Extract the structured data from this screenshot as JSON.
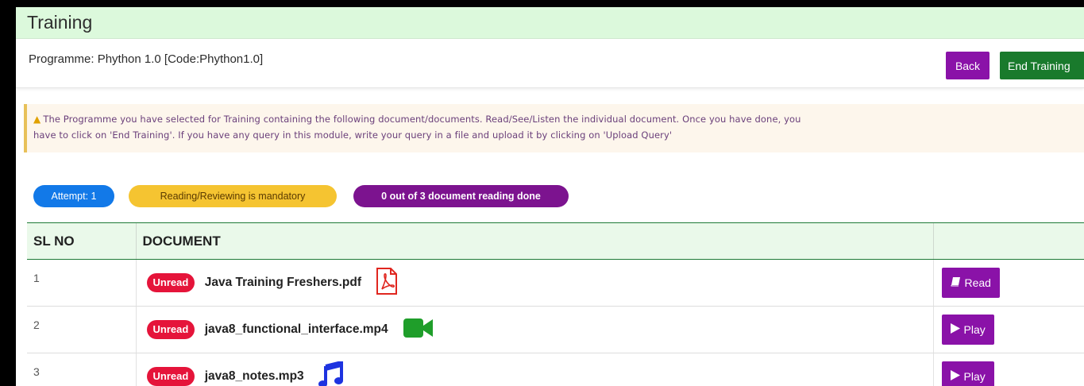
{
  "header": {
    "title": "Training"
  },
  "programme": {
    "label": "Programme: Phython 1.0 [Code:Phython1.0]",
    "back_label": "Back",
    "end_label": "End Training"
  },
  "notice": {
    "line1": "The Programme you have selected for Training containing the following document/documents. Read/See/Listen the individual document. Once you have done, you",
    "line2": "have to click on 'End Training'. If you have any query in this module, write your query in a file and upload it by clicking on 'Upload Query'"
  },
  "badges": {
    "attempt": "Attempt: 1",
    "mandatory": "Reading/Reviewing is mandatory",
    "progress": "0 out of 3 document reading done"
  },
  "table": {
    "headers": [
      "SL NO",
      "DOCUMENT",
      ""
    ],
    "rows": [
      {
        "sl": "1",
        "status": "Unread",
        "name": "Java Training Freshers.pdf",
        "icon": "pdf-icon",
        "action": "Read",
        "action_icon": "book-icon"
      },
      {
        "sl": "2",
        "status": "Unread",
        "name": "java8_functional_interface.mp4",
        "icon": "video-icon",
        "action": "Play",
        "action_icon": "play-icon"
      },
      {
        "sl": "3",
        "status": "Unread",
        "name": "java8_notes.mp3",
        "icon": "music-icon",
        "action": "Play",
        "action_icon": "play-icon"
      }
    ]
  },
  "colors": {
    "title_bg": "#dcf9dc",
    "purple": "#8a12a8",
    "green": "#197a2c",
    "attempt_blue": "#1279e8",
    "mandatory_yellow": "#f5c431",
    "unread_red": "#e5143a"
  }
}
